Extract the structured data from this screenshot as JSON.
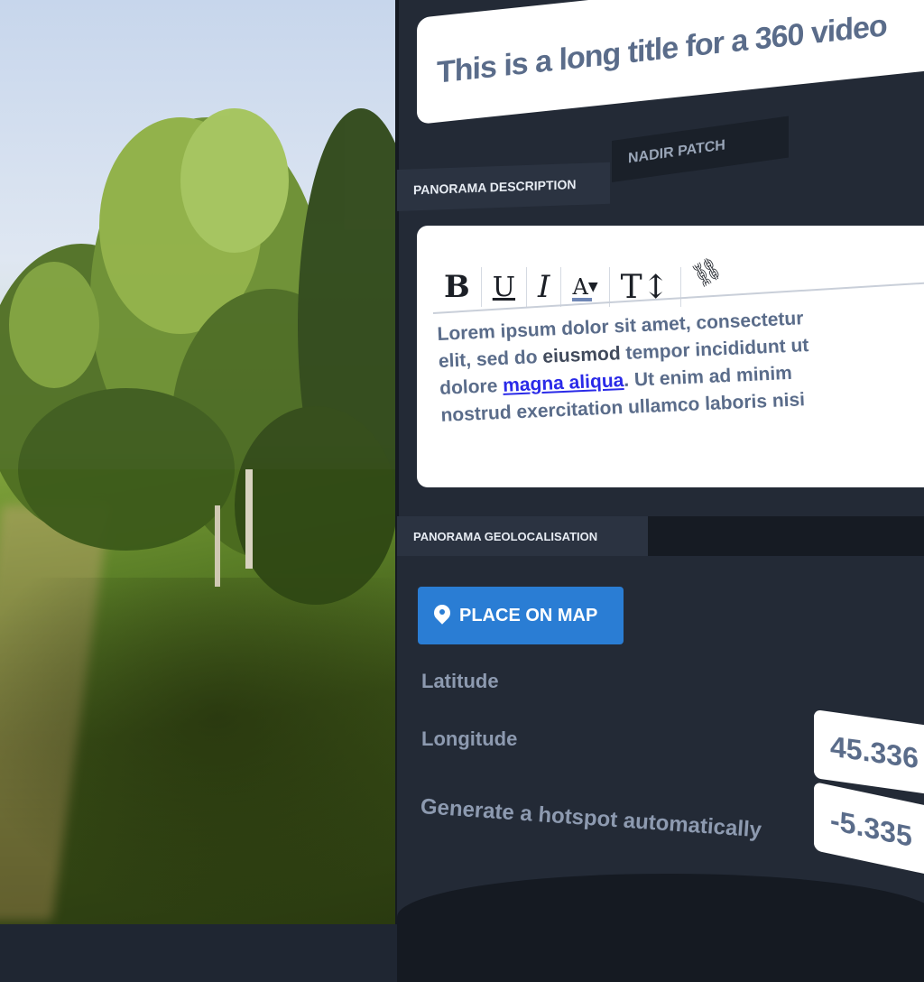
{
  "panel": {
    "title_value": "This is a long title for a 360 video",
    "tabs": [
      {
        "label": "PANORAMA DESCRIPTION"
      },
      {
        "label": "NADIR PATCH"
      }
    ],
    "editor": {
      "toolbar": {
        "bold": "B",
        "underline": "U",
        "italic": "I",
        "font_color": "A",
        "font_size": "T↕",
        "link": "⛓"
      },
      "text": {
        "line1": "Lorem ipsum dolor sit amet, consectetur",
        "line2_pre": "elit, sed do ",
        "line2_bold": "eiusmod",
        "line2_post": " tempor incididunt ut",
        "line3_pre": "dolore ",
        "line3_link": "magna aliqua",
        "line3_post": ". Ut enim ad minim",
        "line4": "nostrud exercitation ullamco laboris nisi"
      }
    },
    "geo": {
      "tab_label": "PANORAMA GEOLOCALISATION",
      "place_button": "PLACE ON MAP",
      "latitude_label": "Latitude",
      "longitude_label": "Longitude",
      "hotspot_label": "Generate a hotspot automatically",
      "latitude_value": "45.336",
      "longitude_value": "-5.335"
    }
  },
  "colors": {
    "panel_bg": "#232a36",
    "card_bg": "#ffffff",
    "accent_blue": "#2a7dd4",
    "text_slate": "#5a6c8a",
    "link_blue": "#2a2ae8"
  }
}
